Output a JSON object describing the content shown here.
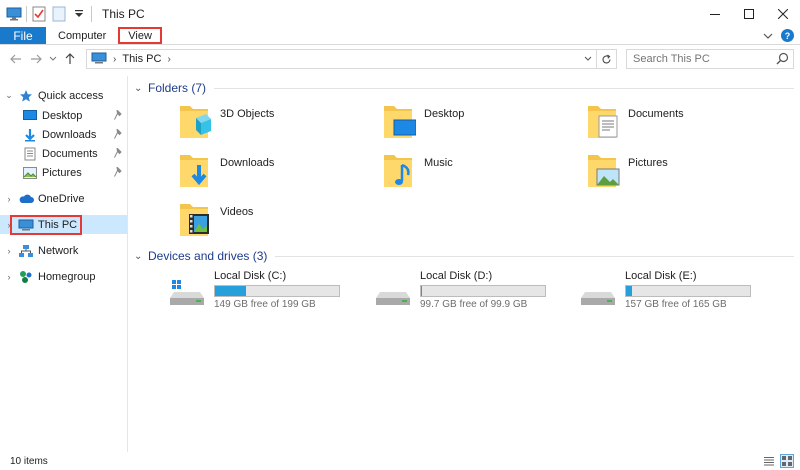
{
  "window": {
    "title": "This PC",
    "controls": [
      "minimize",
      "maximize",
      "close"
    ]
  },
  "ribbon": {
    "tabs": [
      {
        "label": "File"
      },
      {
        "label": "Computer"
      },
      {
        "label": "View"
      }
    ]
  },
  "address": {
    "path": "This PC",
    "search_placeholder": "Search This PC"
  },
  "nav": {
    "quick_access": "Quick access",
    "quick_items": [
      {
        "label": "Desktop"
      },
      {
        "label": "Downloads"
      },
      {
        "label": "Documents"
      },
      {
        "label": "Pictures"
      }
    ],
    "onedrive": "OneDrive",
    "this_pc": "This PC",
    "network": "Network",
    "homegroup": "Homegroup"
  },
  "folders": {
    "header": "Folders (7)",
    "items": [
      {
        "name": "3D Objects"
      },
      {
        "name": "Desktop"
      },
      {
        "name": "Documents"
      },
      {
        "name": "Downloads"
      },
      {
        "name": "Music"
      },
      {
        "name": "Pictures"
      },
      {
        "name": "Videos"
      }
    ]
  },
  "drives": {
    "header": "Devices and drives (3)",
    "items": [
      {
        "name": "Local Disk (C:)",
        "free": "149 GB free of 199 GB",
        "used_fraction": 0.25
      },
      {
        "name": "Local Disk (D:)",
        "free": "99.7 GB free of 99.9 GB",
        "used_fraction": 0.002
      },
      {
        "name": "Local Disk (E:)",
        "free": "157 GB free of 165 GB",
        "used_fraction": 0.05
      }
    ]
  },
  "status": {
    "count": "10 items"
  },
  "colors": {
    "accent": "#1979ca",
    "highlight": "#e53935",
    "selected_bg": "#cce8ff",
    "drive_fill": "#26a0da",
    "group_header": "#1e3c8c"
  }
}
